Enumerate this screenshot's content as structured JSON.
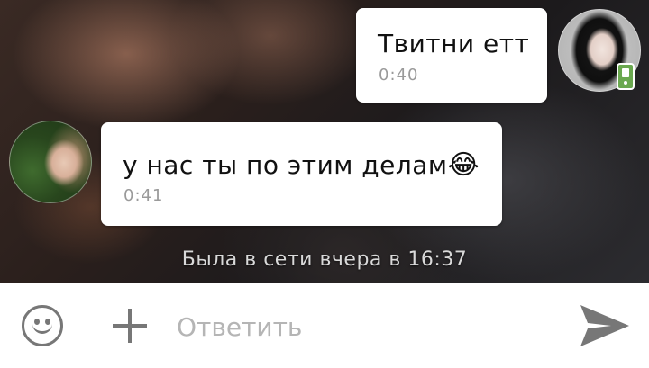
{
  "messages": [
    {
      "direction": "outgoing",
      "text": "Твитни етт",
      "time": "0:40"
    },
    {
      "direction": "incoming",
      "text": "у нас ты по этим делам",
      "emoji": "😂",
      "time": "0:41"
    }
  ],
  "status": {
    "last_seen": "Была в сети вчера в 16:37"
  },
  "composer": {
    "placeholder": "Ответить",
    "emoji_icon": "smiley-face-icon",
    "attach_icon": "plus-icon",
    "send_icon": "send-arrow-icon"
  },
  "icons": {
    "device_badge": "mobile-phone-icon"
  },
  "colors": {
    "bubble": "#ffffff",
    "time_text": "#9a9a9a",
    "icon_gray": "#777777",
    "placeholder": "#b5b5b5",
    "device_badge": "#6aa84f"
  }
}
